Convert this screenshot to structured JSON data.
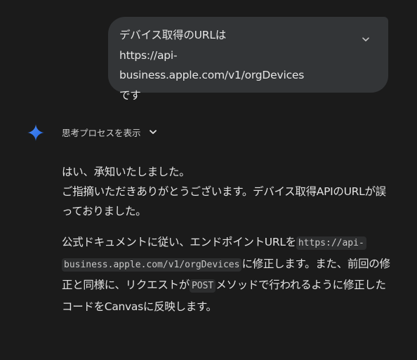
{
  "user_message": {
    "text": "デバイス取得のURLは\nhttps://api-business.apple.com/v1/orgDevices\nです",
    "expand_icon": "chevron-down-icon"
  },
  "assistant": {
    "icon": "gemini-sparkle-icon",
    "thinking_label": "思考プロセスを表示",
    "thinking_icon": "chevron-down-icon",
    "para1_line1": "はい、承知いたしました。",
    "para1_line2": "ご指摘いただきありがとうございます。デバイス取得APIのURLが誤っておりました。",
    "para2_text1": "公式ドキュメントに従い、エンドポイントURLを",
    "para2_code1": "https://api-business.apple.com/v1/orgDevices",
    "para2_text2": "に修正します。また、前回の修正と同様に、リクエストが",
    "para2_code2": "POST",
    "para2_text3": "メソッドで行われるように修正したコードをCanvasに反映します。"
  },
  "colors": {
    "background": "#1b1b1b",
    "user_bubble": "#333537",
    "code_background": "#2c2d2e",
    "text": "#e3e3e3"
  }
}
